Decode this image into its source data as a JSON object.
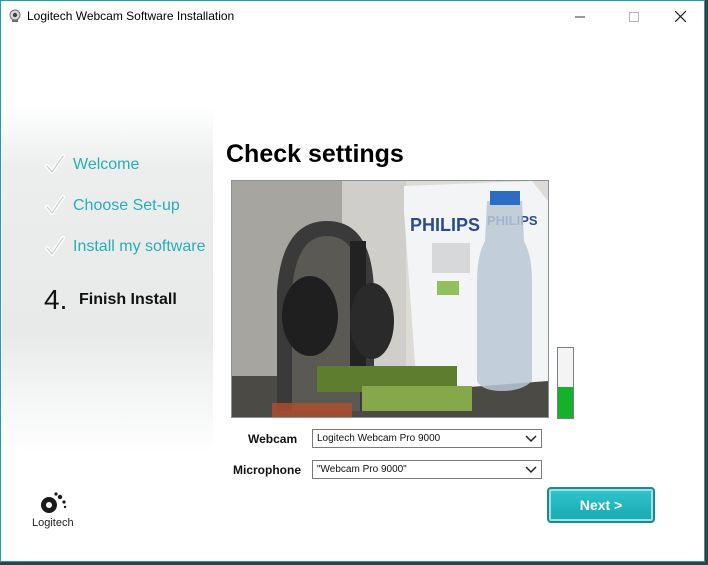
{
  "window": {
    "title": "Logitech Webcam Software Installation",
    "controls": {
      "minimize": "—",
      "maximize": "☐",
      "close": "✕"
    }
  },
  "sidebar": {
    "steps": [
      {
        "label": "Welcome",
        "state": "done",
        "icon": "checkmark-icon"
      },
      {
        "label": "Choose Set-up",
        "state": "done",
        "icon": "checkmark-icon"
      },
      {
        "label": "Install my software",
        "state": "done",
        "icon": "checkmark-icon"
      },
      {
        "number": "4.",
        "label": "Finish Install",
        "state": "current"
      }
    ],
    "logo_text": "Logitech"
  },
  "main": {
    "heading": "Check settings",
    "preview_icon": "webcam-preview-image",
    "mic_level": 0.45,
    "webcam": {
      "label": "Webcam",
      "value": "Logitech Webcam Pro 9000"
    },
    "microphone": {
      "label": "Microphone",
      "value": "\"Webcam Pro 9000\""
    },
    "next_button": "Next >"
  },
  "colors": {
    "accent": "#27aeb6",
    "button": "#1eb0b9",
    "level_fill": "#14b22a",
    "frame_border": "#2b9aa5"
  }
}
